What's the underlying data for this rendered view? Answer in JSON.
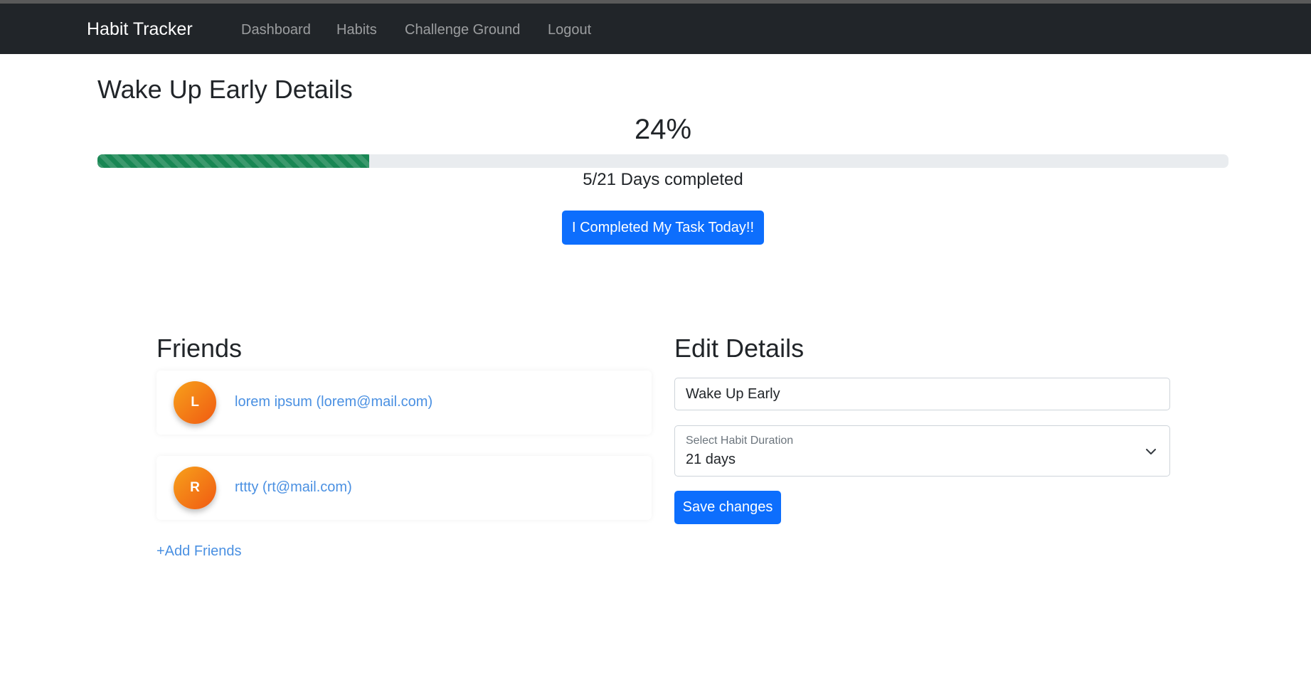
{
  "navbar": {
    "brand": "Habit Tracker",
    "links": [
      "Dashboard",
      "Habits",
      "Challenge Ground",
      "Logout"
    ]
  },
  "habit": {
    "title": "Wake Up Early Details",
    "percent_text": "24%",
    "progress_fraction": 0.24,
    "days_text": "5/21 Days completed",
    "complete_button": "I Completed My Task Today!!"
  },
  "friends": {
    "heading": "Friends",
    "items": [
      {
        "initial": "L",
        "label": "lorem ipsum (lorem@mail.com)"
      },
      {
        "initial": "R",
        "label": "rttty (rt@mail.com)"
      }
    ],
    "add_link": "+Add Friends"
  },
  "edit": {
    "heading": "Edit Details",
    "name_value": "Wake Up Early",
    "duration_label": "Select Habit Duration",
    "duration_value": "21 days",
    "save_button": "Save changes"
  },
  "colors": {
    "navbar_bg": "#212529",
    "primary": "#0d6efd",
    "success": "#198754",
    "link": "#4a90e2"
  }
}
